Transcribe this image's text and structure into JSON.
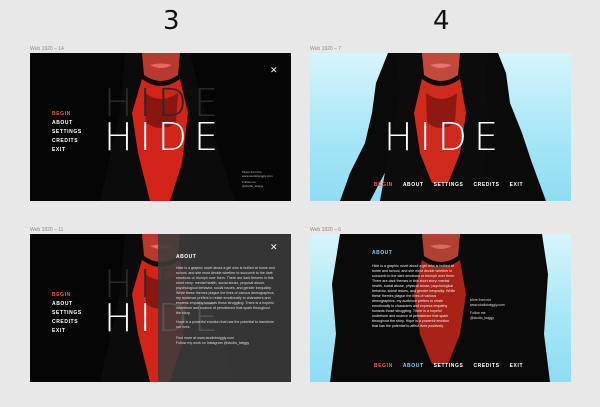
{
  "column_numbers": [
    "3",
    "4"
  ],
  "frames": {
    "f1": {
      "label": "Web 1920 – 14"
    },
    "f2": {
      "label": "Web 1920 – 7"
    },
    "f3": {
      "label": "Web 1920 – 11"
    },
    "f4": {
      "label": "Web 1920 – 6"
    }
  },
  "title": "HIDE",
  "menu": [
    "BEGIN",
    "ABOUT",
    "SETTINGS",
    "CREDITS",
    "EXIT"
  ],
  "close_symbol": "✕",
  "credits_small": {
    "line1": "Music from the",
    "line2": "www.studiotwiggly.com",
    "line3": "Follow me",
    "line4": "@studio_twiggy"
  },
  "about": {
    "title": "ABOUT",
    "p1": "Hide is a graphic novel about a girl who is bullied at home and school, and she must decide whether to succumb to the dark emotions or triumph over them. There are dark themes in this short story: mental health, social abuse, physical abuse, psychological behavior, social issues, and gender inequality. While these themes plague the lives of various demographics, my audience prefers to relate emotionally to characters and express empathy towards those struggling. There is a hopeful undertone and nuance of persistence that spark throughout the story.",
    "p2": "Hope is a powerful emotion that has the potential to transform our lives.",
    "p3": "Find more at www.studiotwiggly.com",
    "p4": "Follow my work on Instagram @studio_twiggy"
  },
  "about_f4": {
    "title": "ABOUT",
    "body": "Hide is a graphic novel about a girl who is bullied at home and school, and she must decide whether to succumb to the dark emotions or triumph over them. There are dark themes in this short story: mental health, social abuse, physical abuse, psychological behavior, social issues, and gender inequality. While these themes plague the lives of various demographics, my audience prefers to relate emotionally to characters and express empathy towards those struggling. There is a hopeful undertone and nuance of persistence that spark throughout the story. Hope is a powerful emotion that has the potential to affect lives positively.",
    "side1": "More from me",
    "side2": "www.studiotwiggly.com",
    "side3": "Follow me",
    "side4": "@studio_twiggy"
  },
  "colors": {
    "accent": "#ff5a4a",
    "dark_bg": "#050505",
    "sky": "#a7e7f6",
    "cyan_text": "#6fd6f0"
  }
}
